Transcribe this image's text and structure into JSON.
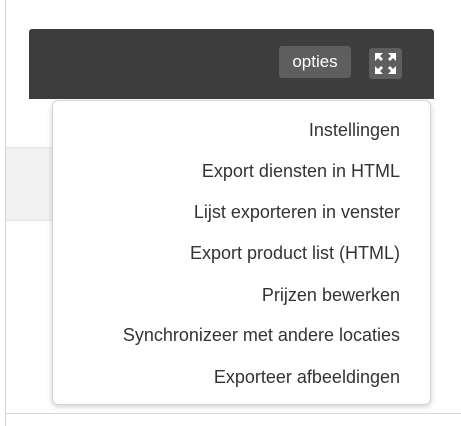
{
  "toolbar": {
    "options_label": "opties",
    "fullscreen_icon": "expand-arrows-icon"
  },
  "menu": {
    "items": [
      {
        "label": "Instellingen"
      },
      {
        "label": "Export diensten in HTML"
      },
      {
        "label": "Lijst exporteren in venster"
      },
      {
        "label": "Export product list (HTML)"
      },
      {
        "label": "Prijzen bewerken"
      },
      {
        "label": "Synchronizeer met andere locaties"
      },
      {
        "label": "Exporteer afbeeldingen"
      }
    ]
  },
  "colors": {
    "toolbar_bg": "#3d3d3d",
    "button_bg": "#5e5e5e",
    "menu_text": "#333333"
  }
}
